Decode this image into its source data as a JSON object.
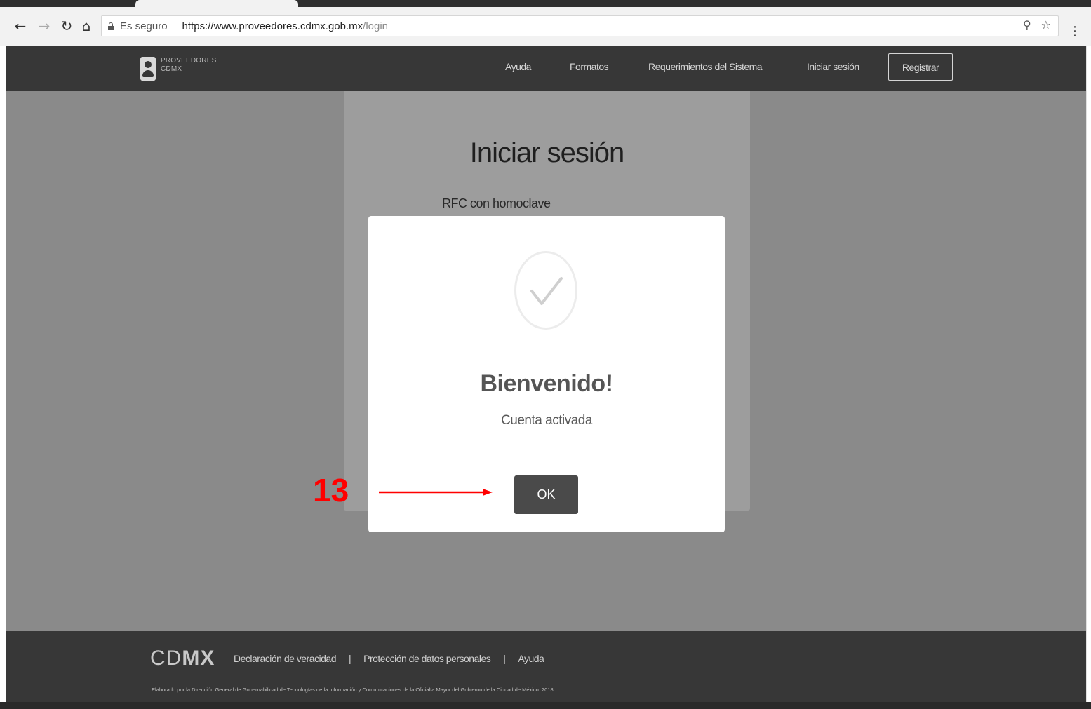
{
  "browser": {
    "secure_label": "Es seguro",
    "url_host": "https://www.proveedores.cdmx.gob.mx",
    "url_path": "/login",
    "nav_icons": [
      "back-arrow-icon",
      "forward-arrow-icon",
      "reload-icon",
      "home-icon"
    ],
    "omnibox_icons": [
      "zoom-icon",
      "bookmark-star-icon"
    ]
  },
  "navbar": {
    "brand_line1": "PROVEEDORES",
    "brand_line2": "CDMX",
    "links": [
      "Ayuda",
      "Formatos",
      "Requerimientos del Sistema",
      "Iniciar sesión"
    ],
    "register_label": "Registrar"
  },
  "login": {
    "title": "Iniciar sesión",
    "rfc_label": "RFC con homoclave"
  },
  "modal": {
    "icon": "checkmark-icon",
    "title": "Bienvenido!",
    "message": "Cuenta activada",
    "ok_label": "OK"
  },
  "annotation": {
    "step": "13",
    "color": "#ff0000"
  },
  "footer": {
    "logo_light": "CD",
    "logo_bold": "MX",
    "links": [
      "Declaración de veracidad",
      "Protección de datos personales",
      "Ayuda"
    ],
    "credit": "Elaborado por la Dirección General de Gobernabilidad de Tecnologías de la Información y Comunicaciones de la Oficialía Mayor del Gobierno de la Ciudad de México. 2018"
  },
  "colors": {
    "navbar": "#373737",
    "overlay_page": "#8a8a8a",
    "modal_button": "#4a4a4a"
  }
}
